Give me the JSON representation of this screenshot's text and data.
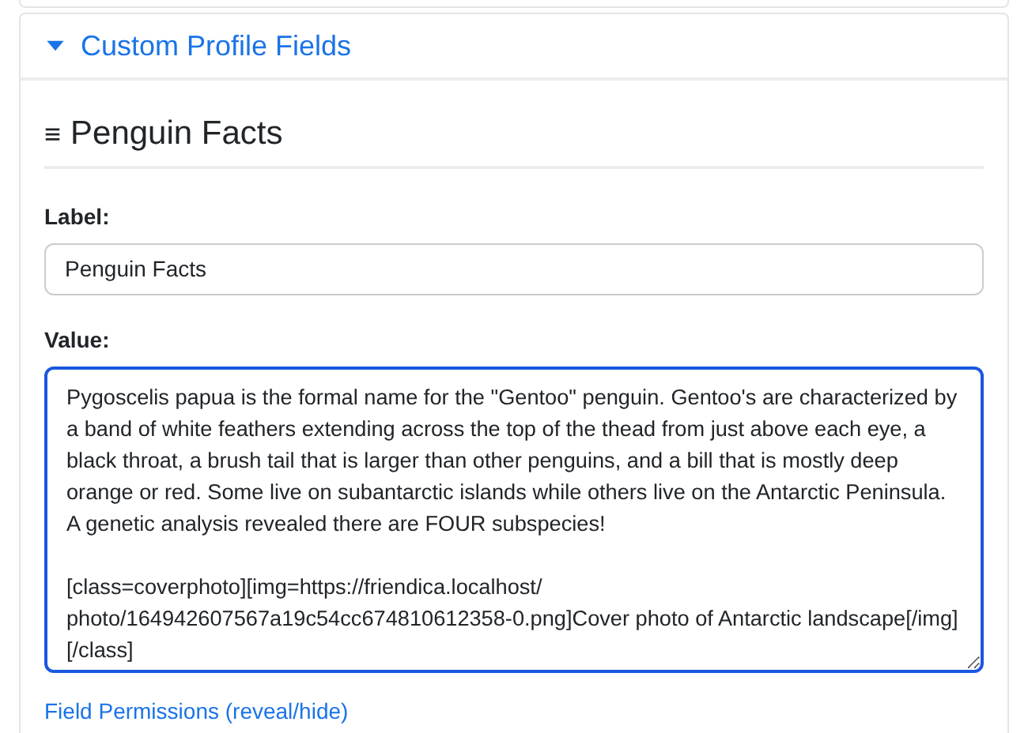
{
  "panel": {
    "title": "Custom Profile Fields",
    "expanded": true
  },
  "field": {
    "handle": "≡",
    "heading": "Penguin Facts",
    "label_caption": "Label:",
    "label_value": "Penguin Facts",
    "value_caption": "Value:",
    "value_focused": true,
    "value_text": "Pygoscelis papua is the formal name for the \"Gentoo\" penguin. Gentoo's are characterized by a band of white feathers extending across the top of the thead from just above each eye, a black throat, a brush tail that is larger than other penguins, and a bill that is mostly deep orange or red. Some live on subantarctic islands while others live on the Antarctic Peninsula. A genetic analysis revealed there are FOUR subspecies!\n\n[class=coverphoto][img=https://friendica.localhost/\nphoto/164942607567a19c54cc674810612358-0.png]Cover photo of Antarctic landscape[/img][/class]",
    "permissions_link": "Field Permissions (reveal/hide)"
  }
}
